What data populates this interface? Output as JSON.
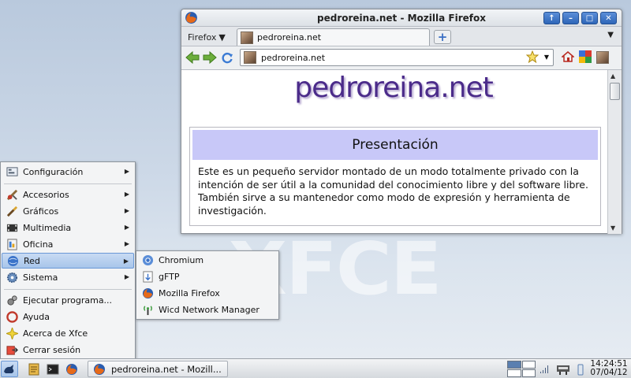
{
  "window": {
    "title": "pedroreina.net - Mozilla Firefox",
    "ff_menu": "Firefox",
    "tab_label": "pedroreina.net",
    "url": "pedroreina.net",
    "page": {
      "site_title": "pedroreina.net",
      "heading": "Presentación",
      "text": "Este es un pequeño servidor montado de un modo totalmente privado con la intención de ser útil a la comunidad del conocimiento libre y del software libre. También sirve a su mantenedor como modo de expresión y herramienta de investigación."
    }
  },
  "main_menu": {
    "items": [
      {
        "label": "Configuración",
        "icon": "settings-icon"
      },
      {
        "label": "Accesorios",
        "icon": "accessories-icon"
      },
      {
        "label": "Gráficos",
        "icon": "graphics-icon"
      },
      {
        "label": "Multimedia",
        "icon": "multimedia-icon"
      },
      {
        "label": "Oficina",
        "icon": "office-icon"
      },
      {
        "label": "Red",
        "icon": "network-icon"
      },
      {
        "label": "Sistema",
        "icon": "system-icon"
      },
      {
        "label": "Ejecutar programa...",
        "icon": "run-icon"
      },
      {
        "label": "Ayuda",
        "icon": "help-icon"
      },
      {
        "label": "Acerca de Xfce",
        "icon": "about-icon"
      },
      {
        "label": "Cerrar sesión",
        "icon": "logout-icon"
      }
    ]
  },
  "sub_menu": {
    "items": [
      {
        "label": "Chromium",
        "icon": "chromium-icon"
      },
      {
        "label": "gFTP",
        "icon": "gftp-icon"
      },
      {
        "label": "Mozilla Firefox",
        "icon": "firefox-icon"
      },
      {
        "label": "Wicd Network Manager",
        "icon": "wicd-icon"
      }
    ]
  },
  "panel": {
    "task_label": "pedroreina.net - Mozill...",
    "time": "14:24:51",
    "date": "07/04/12"
  },
  "desktop": {
    "logo": "XFCE"
  },
  "colors": {
    "accent": "#3a6fc4",
    "selection": "#a7c5ea",
    "heading_bg": "#c8c8f8",
    "site_title": "#4b2b8a"
  }
}
